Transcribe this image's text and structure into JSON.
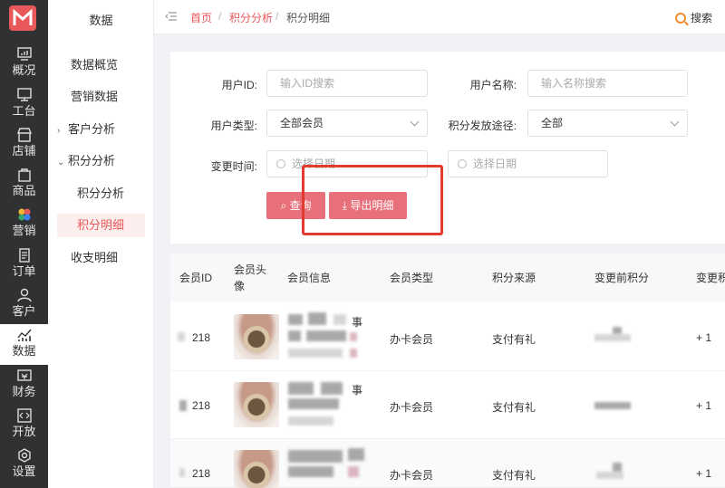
{
  "rail": {
    "items": [
      {
        "label": "概况",
        "icon": "monitor-icon"
      },
      {
        "label": "工台",
        "icon": "desktop-icon"
      },
      {
        "label": "店铺",
        "icon": "shop-icon"
      },
      {
        "label": "商品",
        "icon": "goods-icon"
      },
      {
        "label": "营销",
        "icon": "marketing-icon"
      },
      {
        "label": "订单",
        "icon": "order-icon"
      },
      {
        "label": "客户",
        "icon": "customer-icon"
      },
      {
        "label": "数据",
        "icon": "data-chart-icon"
      },
      {
        "label": "财务",
        "icon": "finance-icon"
      },
      {
        "label": "开放",
        "icon": "code-icon"
      },
      {
        "label": "设置",
        "icon": "gear-icon"
      }
    ]
  },
  "submenu": {
    "title": "数据",
    "items": [
      {
        "label": "数据概览"
      },
      {
        "label": "营销数据"
      },
      {
        "label": "客户分析",
        "arrow": "›"
      },
      {
        "label": "积分分析",
        "arrow": "⌄"
      },
      {
        "label": "积分分析"
      },
      {
        "label": "积分明细"
      },
      {
        "label": "收支明细"
      }
    ]
  },
  "header": {
    "breadcrumb": [
      "首页",
      "积分分析",
      "积分明细"
    ],
    "separator": "/",
    "search_label": "搜索"
  },
  "filter": {
    "user_id_label": "用户ID:",
    "user_id_placeholder": "输入ID搜索",
    "user_name_label": "用户名称:",
    "user_name_placeholder": "输入名称搜索",
    "user_type_label": "用户类型:",
    "user_type_value": "全部会员",
    "grant_label": "积分发放途径:",
    "grant_value": "全部",
    "time_label": "变更时间:",
    "date_placeholder_start": "选择日期",
    "date_placeholder_end": "选择日期",
    "query_button": "查询",
    "export_button": "导出明细"
  },
  "table": {
    "headers": [
      "会员ID",
      "会员头像",
      "会员信息",
      "会员类型",
      "积分来源",
      "变更前积分",
      "变更积"
    ],
    "rows": [
      {
        "id": "218",
        "type": "办卡会员",
        "source": "支付有礼",
        "change": "+ 1"
      },
      {
        "id": "218",
        "type": "办卡会员",
        "source": "支付有礼",
        "change": "+ 1"
      },
      {
        "id": "218",
        "type": "办卡会员",
        "source": "支付有礼",
        "change": "+ 1"
      }
    ]
  },
  "colors": {
    "accent": "#e8585a",
    "button": "#e8707a",
    "rail": "#2f3133",
    "annotation": "#e13b2f"
  }
}
